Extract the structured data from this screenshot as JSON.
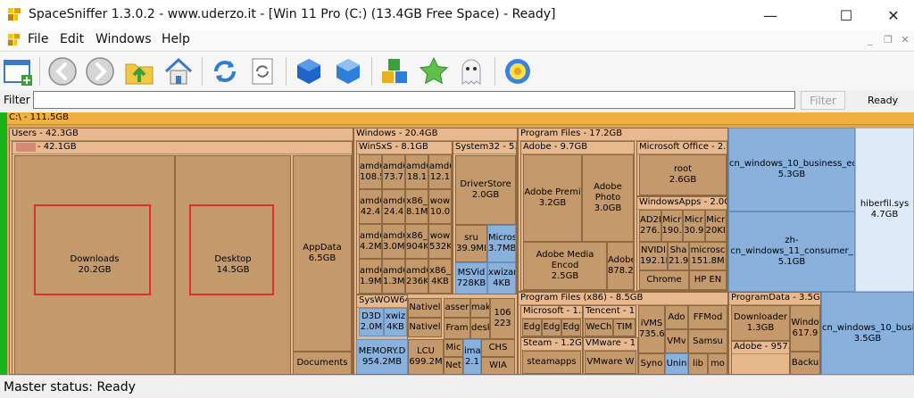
{
  "window": {
    "title": "SpaceSniffer 1.3.0.2 - www.uderzo.it - [Win 11 Pro (C:) (13.4GB Free Space) - Ready]",
    "min_symbol": "—",
    "max_symbol": "☐",
    "close_symbol": "✕"
  },
  "menu": {
    "file": "File",
    "edit": "Edit",
    "windows": "Windows",
    "help": "Help"
  },
  "mdi": {
    "min": "_",
    "restore": "❐",
    "close": "✕"
  },
  "toolbar": {
    "buttons": [
      "new-view-icon",
      "back-icon",
      "forward-icon",
      "folder-up-icon",
      "home-icon",
      "refresh-icon",
      "rescan-icon",
      "cube-icon",
      "cube-light-icon",
      "blocks-icon",
      "star-icon",
      "ghost-icon",
      "settings-gear-icon"
    ]
  },
  "filter": {
    "label": "Filter",
    "value": "",
    "button": "Filter",
    "status": "Ready"
  },
  "treemap": {
    "root": "C:\\ - 111.5GB",
    "users": "Users - 42.3GB",
    "user_sub": "- 42.1GB",
    "downloads": "Downloads",
    "downloads_size": "20.2GB",
    "desktop": "Desktop",
    "desktop_size": "14.5GB",
    "appdata": "AppData",
    "appdata_size": "6.5GB",
    "documents": "Documents",
    "windows": "Windows - 20.4GB",
    "winsxs": "WinSxS - 8.1GB",
    "winsxs_cells": [
      [
        "amd6",
        "108.5"
      ],
      [
        "amd6",
        "73.7"
      ],
      [
        "amd6",
        "18.1"
      ],
      [
        "amd6",
        "12.1"
      ],
      [
        "amd6",
        "42.4"
      ],
      [
        "amd6",
        "24.4"
      ],
      [
        "x86_",
        "8.1M"
      ],
      [
        "wow",
        "10.0"
      ],
      [
        "amd6",
        "4.2M"
      ],
      [
        "amd6",
        "3.0M"
      ],
      [
        "x86_",
        "904K"
      ],
      [
        "wow",
        "532K"
      ],
      [
        "amd6",
        "1.9M"
      ],
      [
        "amd6",
        "1.3M"
      ],
      [
        "amd6",
        "236K"
      ],
      [
        "x86_",
        "4KB"
      ]
    ],
    "system32": "System32 - 5.5",
    "driverstore": "DriverStore",
    "driverstore_size": "2.0GB",
    "sru": "sru",
    "sru_size": "39.9MI",
    "microsoft_s": "Micros",
    "microsoft_s_size": "3.7MB",
    "msvid": "MSVid",
    "msvid_size": "728KB",
    "xwizard": "xwizar",
    "xwizard_size": "4KB",
    "syswow": "SysWOW64",
    "d3d": "D3D",
    "d3d_size": "2.0M",
    "xwiz2": "xwiz",
    "xwiz2_size": "4KB",
    "nativel": "Nativel",
    "native2": "Nativel",
    "assem": "asser",
    "mak": "mak",
    "fram": "Fram",
    "desk": "desk",
    "n106": "106",
    "n223": "223",
    "memory": "MEMORY.D",
    "memory_size": "954.2MB",
    "lcu": "LCU",
    "lcu_size": "699.2M",
    "mic": "Mic",
    "net": "Net",
    "ima": "ima",
    "ima2": "2.1",
    "chs": "CHS",
    "wia": "WIA",
    "pf": "Program Files - 17.2GB",
    "adobe": "Adobe - 9.7GB",
    "premiere": "Adobe Premi",
    "premiere_size": "3.2GB",
    "photoshop": "Adobe Photo",
    "photoshop_size": "3.0GB",
    "media_enc": "Adobe Media Encod",
    "media_enc_size": "2.5GB",
    "adobe3": "Adobe",
    "adobe3_size": "878.2",
    "office": "Microsoft Office - 2.6",
    "root_label": "root",
    "root_size": "2.6GB",
    "windowsapps": "WindowsApps - 2.0G",
    "apps": [
      [
        "AD2I",
        "276.1"
      ],
      [
        "Micr",
        "190.3"
      ],
      [
        "Micr",
        "30.9"
      ],
      [
        "Micr",
        "20KI"
      ]
    ],
    "nvidia": "NVIDI",
    "nvidia_size": "192.1M",
    "sha": "Sha",
    "sha_size": "21.9",
    "microsc": "microsc",
    "microsc_size": "151.8M",
    "chrome": "Chrome",
    "hpen": "HP EN",
    "cn_business": "cn_windows_10_business_editi",
    "cn_business_size": "5.3GB",
    "zh_consumer": "zh-cn_windows_11_consumer_",
    "zh_consumer_size": "5.1GB",
    "hiberfil": "hiberfil.sys",
    "hiberfil_size": "4.7GB",
    "pf86": "Program Files (x86) - 8.5GB",
    "ms13": "Microsoft - 1.3",
    "edg1": "Edg",
    "edg2": "Edg",
    "edg3": "Edg",
    "tencent": "Tencent - 1.",
    "wech": "WeCh",
    "tim": "TIM",
    "ivms": "iVMS",
    "ivms_size": "735.6",
    "ado": "Ado",
    "vmw": "VMv",
    "ffmod": "FFMod",
    "samsu": "Samsu",
    "steam": "Steam - 1.2GE",
    "steamapps": "steamapps",
    "vmware": "VMware - 1",
    "vmware_w": "VMware W",
    "syno": "Syno",
    "unin": "Unin",
    "lib": "lib",
    "mo": "mo",
    "programdata": "ProgramData - 3.5GB",
    "downloader": "Downloader",
    "downloader_size": "1.3GB",
    "windo": "Windo",
    "windo_size": "617.9",
    "adobe957": "Adobe - 957.9",
    "backu": "Backu",
    "cn_business2": "cn_windows_10_busin",
    "cn_business2_size": "3.5GB"
  },
  "status": {
    "text": "Master status: Ready"
  }
}
